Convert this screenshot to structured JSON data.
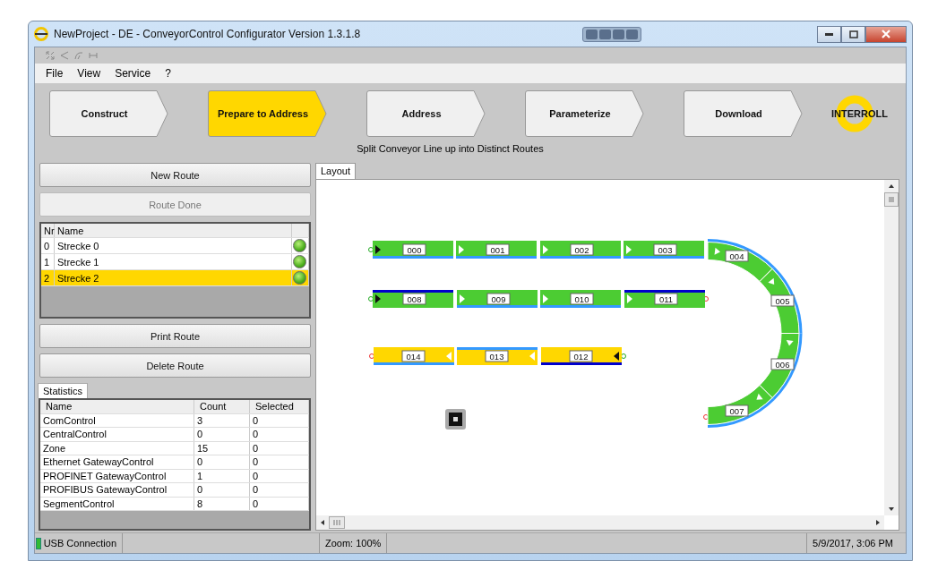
{
  "window": {
    "title": "NewProject - DE - ConveyorControl Configurator Version 1.3.1.8"
  },
  "menu": [
    "File",
    "View",
    "Service",
    "?"
  ],
  "steps": [
    {
      "label": "Construct",
      "selected": false
    },
    {
      "label": "Prepare to Address",
      "selected": true
    },
    {
      "label": "Address",
      "selected": false
    },
    {
      "label": "Parameterize",
      "selected": false
    },
    {
      "label": "Download",
      "selected": false
    }
  ],
  "step_hint": "Split Conveyor Line up into Distinct Routes",
  "logo": "INTERROLL",
  "route_buttons": [
    {
      "label": "New Route",
      "disabled": false
    },
    {
      "label": "Route Done",
      "disabled": true
    }
  ],
  "routes": {
    "columns": [
      "Nr",
      "Name"
    ],
    "rows": [
      {
        "nr": "0",
        "name": "Strecke 0",
        "selected": false
      },
      {
        "nr": "1",
        "name": "Strecke 1",
        "selected": false
      },
      {
        "nr": "2",
        "name": "Strecke 2",
        "selected": true
      }
    ]
  },
  "route_actions": [
    "Print Route",
    "Delete Route"
  ],
  "statistics": {
    "tab": "Statistics",
    "columns": [
      "Name",
      "Count",
      "Selected"
    ],
    "rows": [
      [
        "ComControl",
        "3",
        "0"
      ],
      [
        "CentralControl",
        "0",
        "0"
      ],
      [
        "Zone",
        "15",
        "0"
      ],
      [
        "Ethernet GatewayControl",
        "0",
        "0"
      ],
      [
        "PROFINET GatewayControl",
        "1",
        "0"
      ],
      [
        "PROFIBUS GatewayControl",
        "0",
        "0"
      ],
      [
        "SegmentControl",
        "8",
        "0"
      ]
    ]
  },
  "layout": {
    "tab": "Layout",
    "segments": [
      {
        "label": "000",
        "selected": false
      },
      {
        "label": "001",
        "selected": false
      },
      {
        "label": "002",
        "selected": false
      },
      {
        "label": "003",
        "selected": false
      },
      {
        "label": "004",
        "selected": false
      },
      {
        "label": "005",
        "selected": false
      },
      {
        "label": "006",
        "selected": false
      },
      {
        "label": "007",
        "selected": false
      },
      {
        "label": "008",
        "selected": false
      },
      {
        "label": "009",
        "selected": false
      },
      {
        "label": "010",
        "selected": false
      },
      {
        "label": "011",
        "selected": false
      },
      {
        "label": "014",
        "selected": true
      },
      {
        "label": "013",
        "selected": true
      },
      {
        "label": "012",
        "selected": true
      }
    ]
  },
  "status_bar": {
    "connection": "USB Connection",
    "zoom": "Zoom: 100%",
    "datetime": "5/9/2017, 3:06 PM"
  }
}
